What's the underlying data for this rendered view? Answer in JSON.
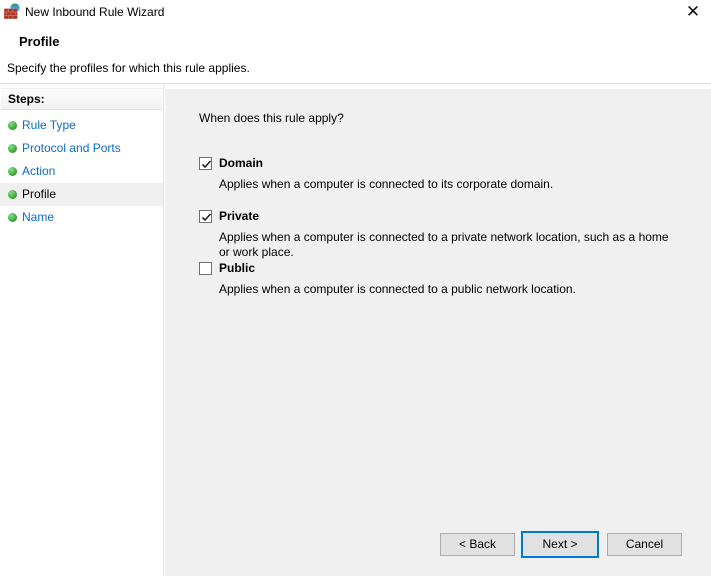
{
  "window": {
    "title": "New Inbound Rule Wizard",
    "close_glyph": "✕"
  },
  "header": {
    "title": "Profile",
    "subtitle": "Specify the profiles for which this rule applies."
  },
  "sidebar": {
    "heading": "Steps:",
    "items": [
      {
        "label": "Rule Type",
        "active": false
      },
      {
        "label": "Protocol and Ports",
        "active": false
      },
      {
        "label": "Action",
        "active": false
      },
      {
        "label": "Profile",
        "active": true
      },
      {
        "label": "Name",
        "active": false
      }
    ]
  },
  "main": {
    "question": "When does this rule apply?",
    "options": [
      {
        "label": "Domain",
        "checked": true,
        "description": "Applies when a computer is connected to its corporate domain."
      },
      {
        "label": "Private",
        "checked": true,
        "description": "Applies when a computer is connected to a private network location, such as a home or work place."
      },
      {
        "label": "Public",
        "checked": false,
        "description": "Applies when a computer is connected to a public network location."
      }
    ]
  },
  "buttons": {
    "back": "< Back",
    "next": "Next >",
    "cancel": "Cancel"
  },
  "colors": {
    "steps_link_blue": "#0a6ccc",
    "focus_border_blue": "#0078d7",
    "bullet_green": "#2ca32c",
    "main_background": "#f0f0f0",
    "divider_gray": "#dfdfdf",
    "button_face": "#e1e1e1",
    "button_border": "#adadad",
    "brick_red": "#a93226",
    "globe_blue": "#3aa0dd"
  }
}
